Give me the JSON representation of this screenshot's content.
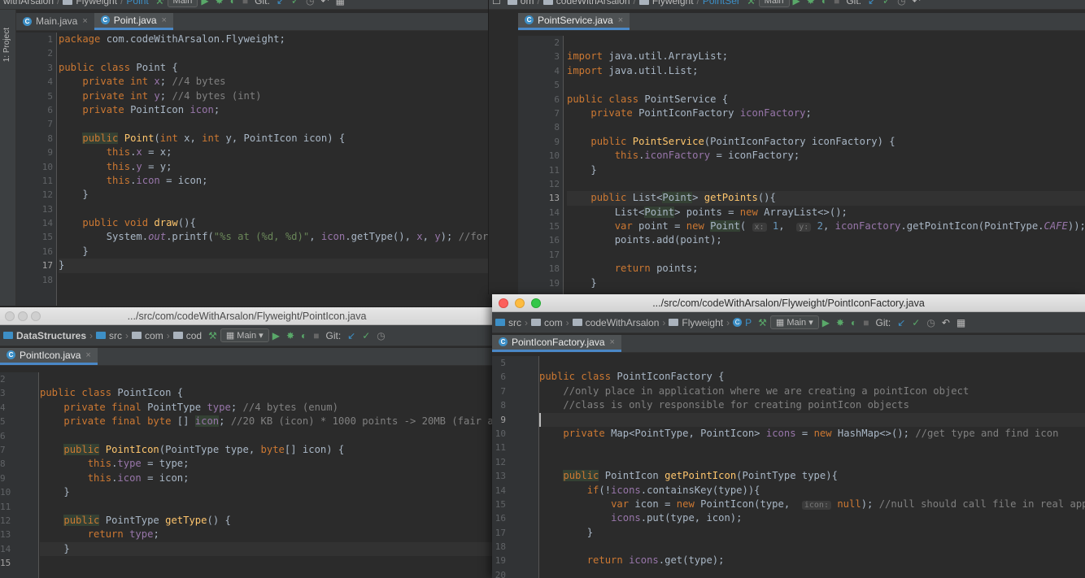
{
  "top_left_toolbar": {
    "project": "withArsalon",
    "crumb1": "Flyweight",
    "crumb2": "Point",
    "config": "Main",
    "git": "Git:"
  },
  "top_right_toolbar": {
    "crumb1": "om",
    "crumb2": "codeWithArsalon",
    "crumb3": "Flyweight",
    "crumb4": "PointSer",
    "config": "Main",
    "git": "Git:"
  },
  "side_tool_label": "1: Project",
  "editor_point": {
    "tabs": [
      {
        "label": "Main.java"
      },
      {
        "label": "Point.java"
      }
    ],
    "line_numbers": [
      "1",
      "2",
      "3",
      "4",
      "5",
      "6",
      "7",
      "8",
      "9",
      "10",
      "11",
      "12",
      "13",
      "14",
      "15",
      "16",
      "17",
      "18"
    ]
  },
  "editor_pointservice": {
    "tabs": [
      {
        "label": "PointService.java"
      }
    ],
    "line_numbers": [
      "2",
      "3",
      "4",
      "5",
      "6",
      "7",
      "8",
      "9",
      "10",
      "11",
      "12",
      "13",
      "14",
      "15",
      "16",
      "17",
      "18",
      "19"
    ]
  },
  "window_pointicon": {
    "title": ".../src/com/codeWithArsalon/Flyweight/PointIcon.java",
    "breadcrumb": [
      "DataStructures",
      "src",
      "com",
      "cod"
    ],
    "config": "Main",
    "git": "Git:",
    "tabs": [
      {
        "label": "PointIcon.java"
      }
    ],
    "line_numbers": [
      "2",
      "3",
      "4",
      "5",
      "6",
      "7",
      "8",
      "9",
      "10",
      "11",
      "12",
      "13",
      "14",
      "15"
    ]
  },
  "window_pointiconfactory": {
    "title": ".../src/com/codeWithArsalon/Flyweight/PointIconFactory.java",
    "breadcrumb": [
      "src",
      "com",
      "codeWithArsalon",
      "Flyweight",
      "P"
    ],
    "config": "Main",
    "git": "Git:",
    "tabs": [
      {
        "label": "PointIconFactory.java"
      }
    ],
    "line_numbers": [
      "5",
      "6",
      "7",
      "8",
      "9",
      "10",
      "11",
      "12",
      "13",
      "14",
      "15",
      "16",
      "17",
      "18",
      "19",
      "20"
    ]
  },
  "colors": {
    "keyword": "#cc7832",
    "function": "#ffc66d",
    "field": "#9876aa",
    "comment": "#808080",
    "string": "#6a8759",
    "number": "#6897bb",
    "background": "#2b2b2b"
  }
}
